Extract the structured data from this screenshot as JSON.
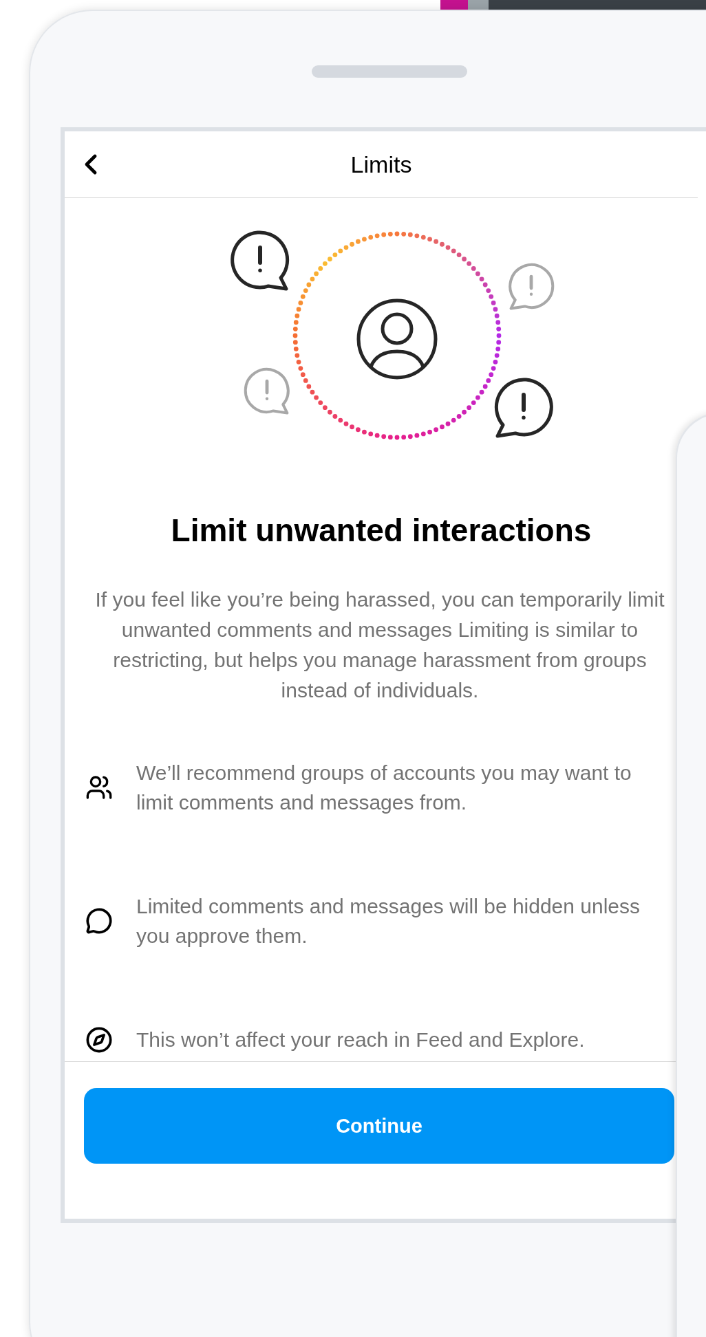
{
  "header": {
    "title": "Limits"
  },
  "heading": "Limit unwanted interactions",
  "description": "If you feel like you’re being harassed, you can temporarily limit unwanted comments and messages Limiting is similar to restricting, but helps you manage harassment from groups instead of individuals.",
  "features": [
    {
      "kind": "people",
      "text": "We’ll recommend groups of accounts you may want to limit comments and messages from."
    },
    {
      "kind": "chat",
      "text": "Limited comments and messages will be hidden unless you approve them."
    },
    {
      "kind": "compass",
      "text": "This won’t affect your reach in Feed and Explore."
    }
  ],
  "continue_button": {
    "label": "Continue"
  }
}
